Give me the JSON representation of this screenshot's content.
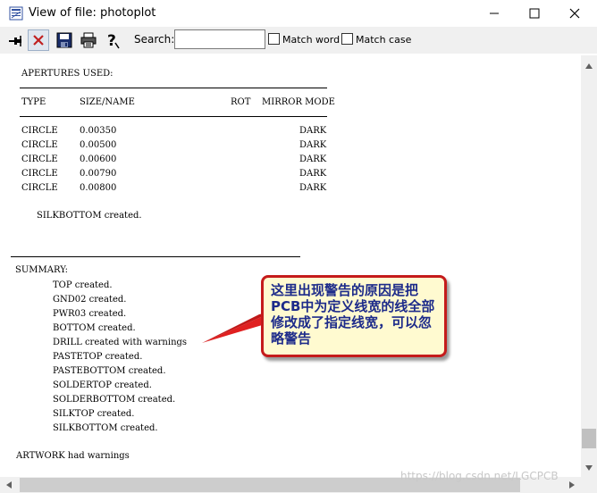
{
  "window": {
    "title": "View of file: photoplot",
    "minimize_glyph": "—",
    "maximize_glyph": "☐",
    "close_glyph": "✕"
  },
  "toolbar": {
    "search_label": "Search:",
    "search_value": "",
    "match_word_label": "Match word",
    "match_case_label": "Match case",
    "buttons": [
      "pin-icon",
      "delete-icon",
      "save-icon",
      "print-icon",
      "help-icon"
    ]
  },
  "file": {
    "apertures_heading": "APERTURES USED:",
    "columns": {
      "type": "TYPE",
      "size": "SIZE/NAME",
      "rot": "ROT",
      "mirror": "MIRROR MODE"
    },
    "rows": [
      {
        "type": "CIRCLE",
        "size": "0.00350",
        "mode": "DARK"
      },
      {
        "type": "CIRCLE",
        "size": "0.00500",
        "mode": "DARK"
      },
      {
        "type": "CIRCLE",
        "size": "0.00600",
        "mode": "DARK"
      },
      {
        "type": "CIRCLE",
        "size": "0.00790",
        "mode": "DARK"
      },
      {
        "type": "CIRCLE",
        "size": "0.00800",
        "mode": "DARK"
      }
    ],
    "silkbottom_line": "SILKBOTTOM created.",
    "summary_heading": "SUMMARY:",
    "summary_lines": [
      "TOP created.",
      "GND02 created.",
      "PWR03 created.",
      "BOTTOM created.",
      "DRILL created with warnings",
      "PASTETOP created.",
      "PASTEBOTTOM created.",
      "SOLDERTOP created.",
      "SOLDERBOTTOM created.",
      "SILKTOP created.",
      "SILKBOTTOM created."
    ],
    "artwork_line": "ARTWORK had warnings"
  },
  "callout": {
    "text": "这里出现警告的原因是把PCB中为定义线宽的线全部修改成了指定线宽，可以忽略警告",
    "colors": {
      "fill": "#fffad0",
      "border": "#c51b1b",
      "text": "#1d2b8a",
      "arrow": "#e02020"
    }
  },
  "watermark": "https://blog.csdn.net/LGCPCB"
}
